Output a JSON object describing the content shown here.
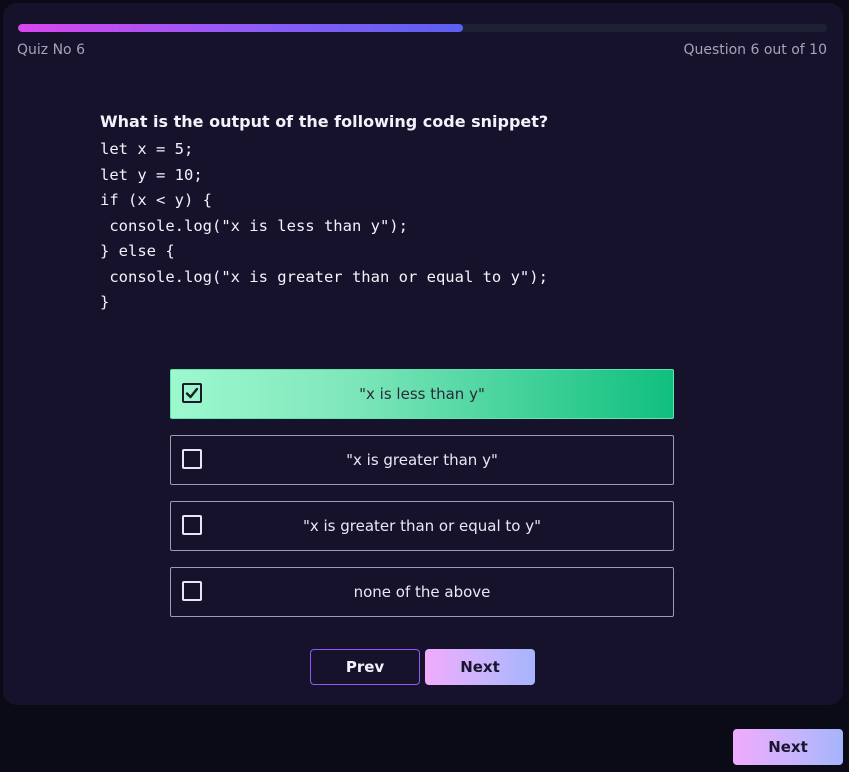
{
  "header": {
    "quiz_label": "Quiz No 6",
    "question_counter": "Question 6 out of 10",
    "progress_percent": 55
  },
  "question": {
    "prompt": "What is the output of the following code snippet?",
    "code_lines": [
      "let x = 5;",
      "let y = 10;",
      "if (x < y) {",
      " console.log(\"x is less than y\");",
      "} else {",
      " console.log(\"x is greater than or equal to y\");",
      "}"
    ]
  },
  "options": [
    {
      "label": "\"x is less than y\"",
      "checked": true
    },
    {
      "label": "\"x is greater than y\"",
      "checked": false
    },
    {
      "label": "\"x is greater than or equal to y\"",
      "checked": false
    },
    {
      "label": "none of the above",
      "checked": false
    }
  ],
  "navigation": {
    "prev_label": "Prev",
    "next_label": "Next"
  },
  "footer": {
    "next_label": "Next"
  },
  "colors": {
    "progress_start": "#d946ef",
    "progress_end": "#5b5ff0",
    "selected_option": "#10bf7e",
    "button_gradient_start": "#f0abfc",
    "button_gradient_end": "#a5b4fc"
  }
}
